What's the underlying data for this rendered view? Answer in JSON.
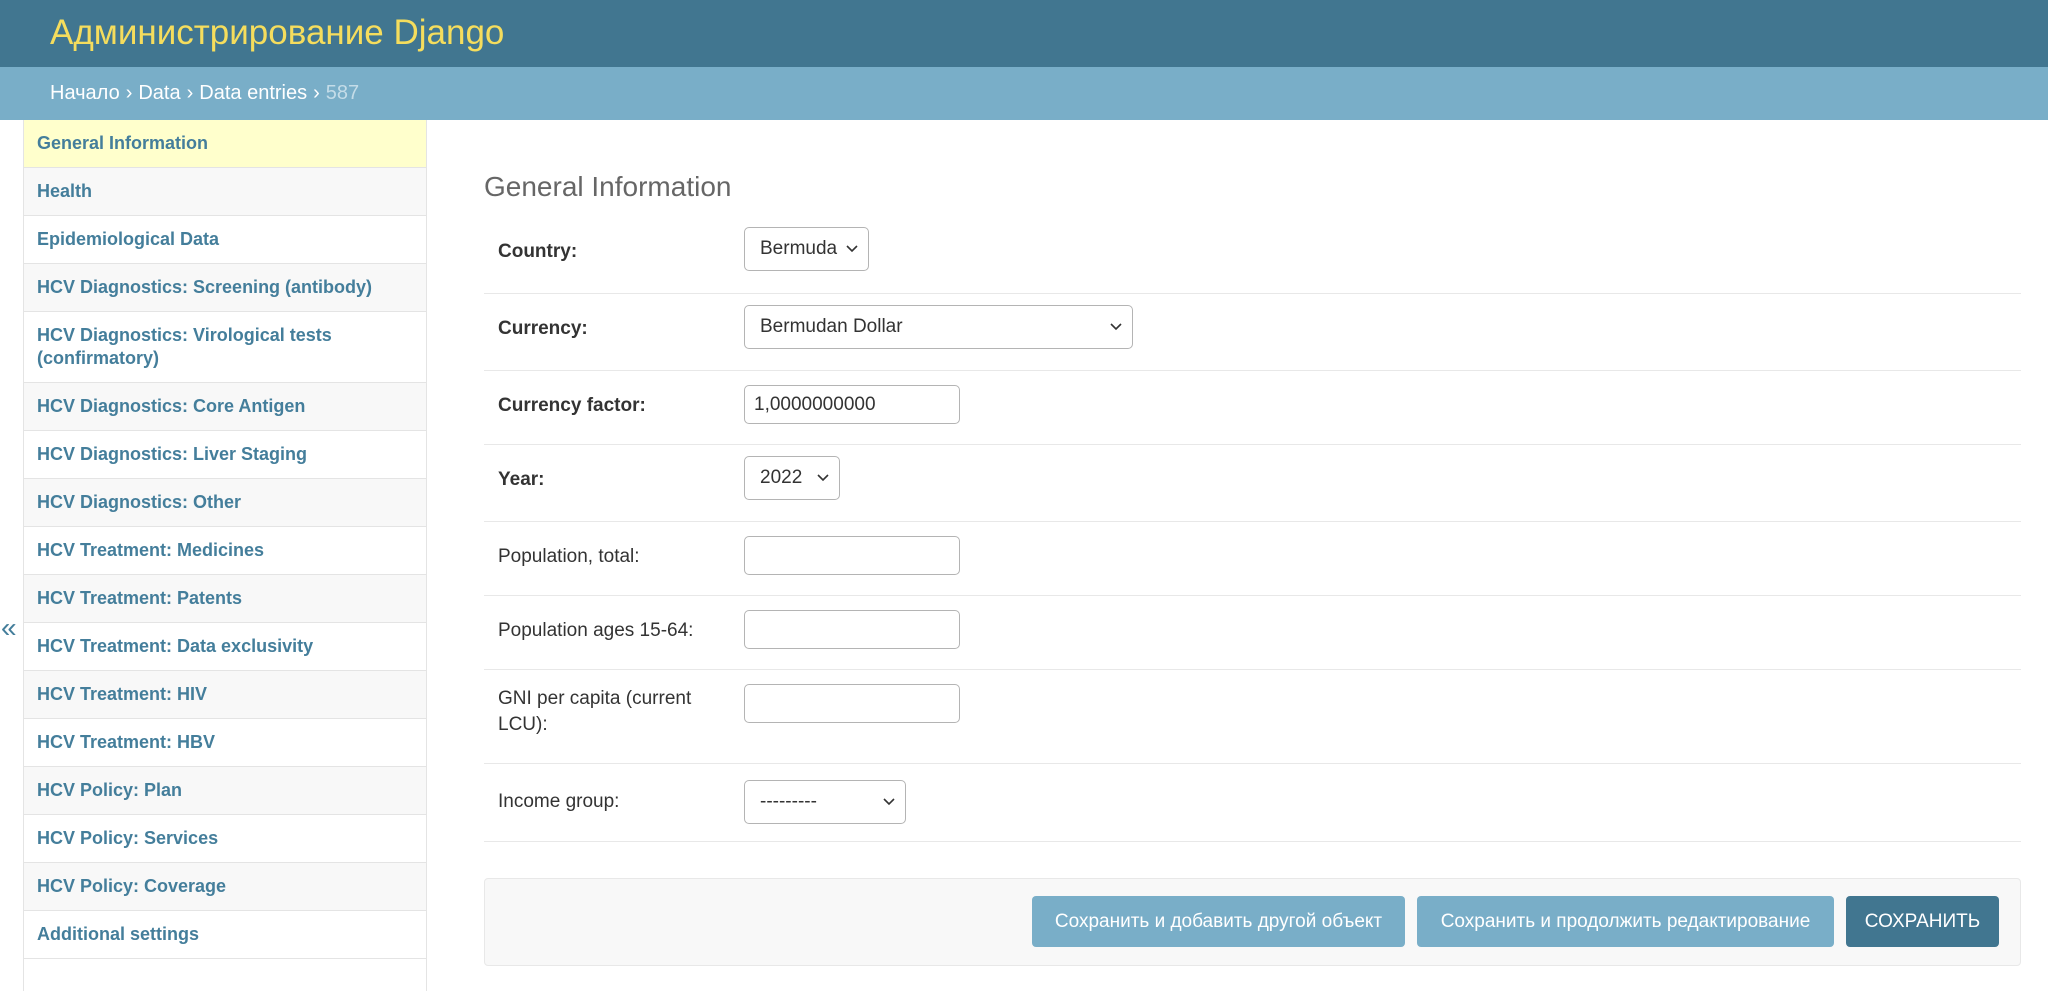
{
  "header": {
    "site_title": "Администрирование Django"
  },
  "breadcrumbs": {
    "home": "Начало",
    "app": "Data",
    "model": "Data entries",
    "current": "587",
    "separator": "›"
  },
  "sidebar": {
    "collapse_glyph": "«",
    "items": [
      {
        "label": "General Information",
        "active": true
      },
      {
        "label": "Health"
      },
      {
        "label": "Epidemiological Data"
      },
      {
        "label": "HCV Diagnostics: Screening (antibody)"
      },
      {
        "label": "HCV Diagnostics: Virological tests (confirmatory)"
      },
      {
        "label": "HCV Diagnostics: Core Antigen"
      },
      {
        "label": "HCV Diagnostics: Liver Staging"
      },
      {
        "label": "HCV Diagnostics: Other"
      },
      {
        "label": "HCV Treatment: Medicines"
      },
      {
        "label": "HCV Treatment: Patents"
      },
      {
        "label": "HCV Treatment: Data exclusivity"
      },
      {
        "label": "HCV Treatment: HIV"
      },
      {
        "label": "HCV Treatment: HBV"
      },
      {
        "label": "HCV Policy: Plan"
      },
      {
        "label": "HCV Policy: Services"
      },
      {
        "label": "HCV Policy: Coverage"
      },
      {
        "label": "Additional settings"
      }
    ]
  },
  "form": {
    "title": "General Information",
    "country": {
      "label": "Country:",
      "value": "Bermuda"
    },
    "currency": {
      "label": "Currency:",
      "value": "Bermudan Dollar"
    },
    "currency_factor": {
      "label": "Currency factor:",
      "value": "1,0000000000"
    },
    "year": {
      "label": "Year:",
      "value": "2022"
    },
    "population_total": {
      "label": "Population, total:",
      "value": ""
    },
    "population_15_64": {
      "label": "Population ages 15-64:",
      "value": ""
    },
    "gni": {
      "label": "GNI per capita (current LCU):",
      "value": ""
    },
    "income_group": {
      "label": "Income group:",
      "value": "---------"
    }
  },
  "actions": {
    "save_add_another": "Сохранить и добавить другой объект",
    "save_continue": "Сохранить и продолжить редактирование",
    "save": "Сохранить"
  },
  "colors": {
    "header_bg": "#417690",
    "site_title": "#f5dd5d",
    "breadcrumb_bg": "#79aec8",
    "link": "#447e9b",
    "active_nav_bg": "#ffffcc"
  }
}
